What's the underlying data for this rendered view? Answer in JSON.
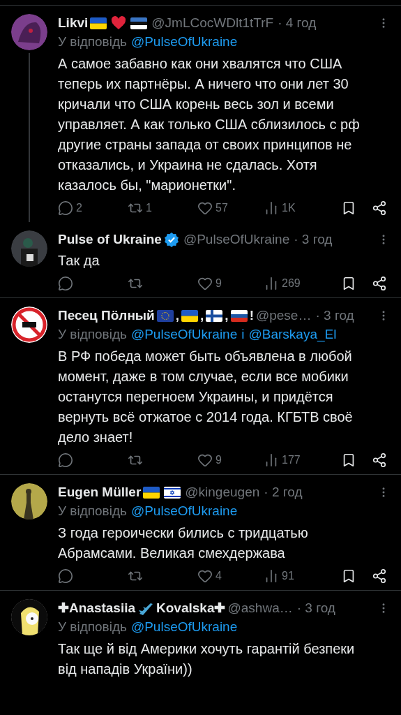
{
  "tweets": [
    {
      "name_parts": [
        {
          "kind": "text",
          "text": "Likvi"
        },
        {
          "kind": "flag_ua"
        },
        {
          "kind": "heart"
        },
        {
          "kind": "flag_ee"
        }
      ],
      "verified": false,
      "handle": "@JmLCocWDlt1tTrF",
      "time": "· 4 год",
      "reply_prefix": "У відповідь",
      "reply_to": [
        "@PulseOfUkraine"
      ],
      "text": "А самое забавно как они хвалятся что США теперь их партнёры. А ничего что они лет 30 кричали что США корень весь зол и всеми управляет. А как только США сблизилось с рф другие страны запада от своих принципов не отказались, и Украина не сдалась. Хотя казалось бы, \"марионетки\".",
      "thread": true,
      "stats": {
        "replies": "2",
        "reposts": "1",
        "likes": "57",
        "views": "1K"
      }
    },
    {
      "name_parts": [
        {
          "kind": "text",
          "text": "Pulse of Ukraine"
        }
      ],
      "verified": true,
      "handle": "@PulseOfUkraine",
      "time": "· 3 год",
      "text": "Так да",
      "thread": false,
      "stats": {
        "likes": "9",
        "views": "269"
      }
    },
    {
      "name_parts": [
        {
          "kind": "text",
          "text": "Песец Пöлный"
        },
        {
          "kind": "flag_eu"
        },
        {
          "kind": "text",
          "text": ","
        },
        {
          "kind": "flag_ua"
        },
        {
          "kind": "text",
          "text": ","
        },
        {
          "kind": "flag_fi"
        },
        {
          "kind": "text",
          "text": ","
        },
        {
          "kind": "flag_ru"
        },
        {
          "kind": "text",
          "text": "!"
        }
      ],
      "verified": false,
      "handle": "@pese…",
      "time": "· 3 год",
      "reply_prefix": "У відповідь",
      "reply_to": [
        "@PulseOfUkraine",
        "@Barskaya_El"
      ],
      "reply_join": "і",
      "text": "В РФ победа может быть объявлена в любой момент, даже в том случае, если все мобики останутся перегноем Украины, и придётся вернуть всё отжатое с 2014 года. КГБТВ своё дело знает!",
      "thread": false,
      "stats": {
        "likes": "9",
        "views": "177"
      }
    },
    {
      "name_parts": [
        {
          "kind": "text",
          "text": "Eugen Müller"
        },
        {
          "kind": "flag_ua"
        },
        {
          "kind": "flag_il"
        }
      ],
      "verified": false,
      "handle": "@kingeugen",
      "time": "· 2 год",
      "reply_prefix": "У відповідь",
      "reply_to": [
        "@PulseOfUkraine"
      ],
      "text": "З года героически бились с тридцатью Абрамсами. Великая смехдержава",
      "thread": false,
      "stats": {
        "likes": "4",
        "views": "91"
      }
    },
    {
      "name_parts": [
        {
          "kind": "text",
          "text": "✚Anastasiia"
        },
        {
          "kind": "plane"
        },
        {
          "kind": "text",
          "text": "Kovalska✚"
        }
      ],
      "verified": false,
      "handle": "@ashwa…",
      "time": "· 3 год",
      "reply_prefix": "У відповідь",
      "reply_to": [
        "@PulseOfUkraine"
      ],
      "text": "Так ще й від Америки хочуть гарантій безпеки від нападів України))",
      "thread": false
    }
  ]
}
